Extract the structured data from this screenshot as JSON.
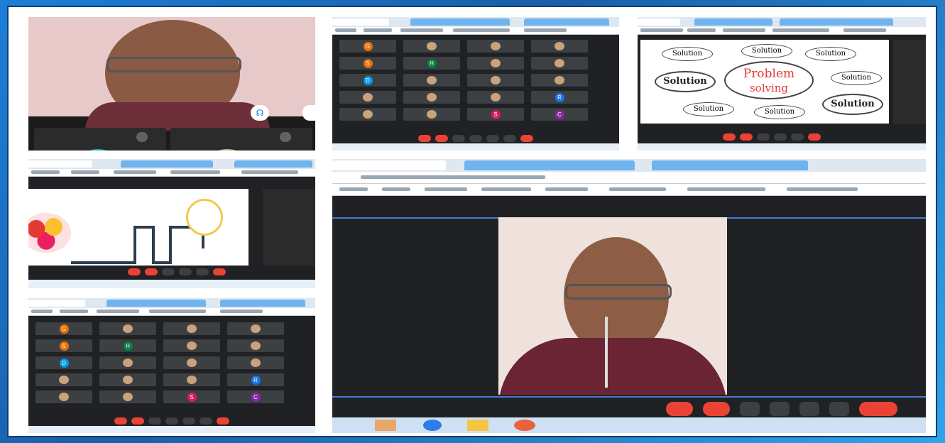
{
  "slide_problem": {
    "center_line1": "Problem",
    "center_line2": "solving",
    "node_big": "Solution",
    "node_small": "Solution"
  },
  "participant_grid": {
    "tiles": [
      {
        "letter": "G",
        "color": "#e8710a"
      },
      {
        "letter": "",
        "color": ""
      },
      {
        "letter": "",
        "color": ""
      },
      {
        "letter": "",
        "color": ""
      },
      {
        "letter": "S",
        "color": "#e8710a"
      },
      {
        "letter": "H",
        "color": "#0b8043"
      },
      {
        "letter": "",
        "color": ""
      },
      {
        "letter": "",
        "color": ""
      },
      {
        "letter": "D",
        "color": "#039be5"
      },
      {
        "letter": "",
        "color": ""
      },
      {
        "letter": "",
        "color": ""
      },
      {
        "letter": "",
        "color": ""
      },
      {
        "letter": "",
        "color": ""
      },
      {
        "letter": "",
        "color": ""
      },
      {
        "letter": "",
        "color": ""
      },
      {
        "letter": "R",
        "color": "#1a73e8"
      },
      {
        "letter": "",
        "color": ""
      },
      {
        "letter": "",
        "color": ""
      },
      {
        "letter": "S",
        "color": "#d81b60"
      },
      {
        "letter": "C",
        "color": "#8e24aa"
      }
    ]
  },
  "colors": {
    "meet_dark": "#202124",
    "tile": "#3c4043",
    "end_call": "#ea4335",
    "chrome": "#dfe7f1"
  },
  "icons": [
    "pin-icon",
    "fullscreen-icon",
    "mic-off-icon",
    "lightbulb-icon",
    "brain-gear-icon",
    "end-call-icon"
  ]
}
